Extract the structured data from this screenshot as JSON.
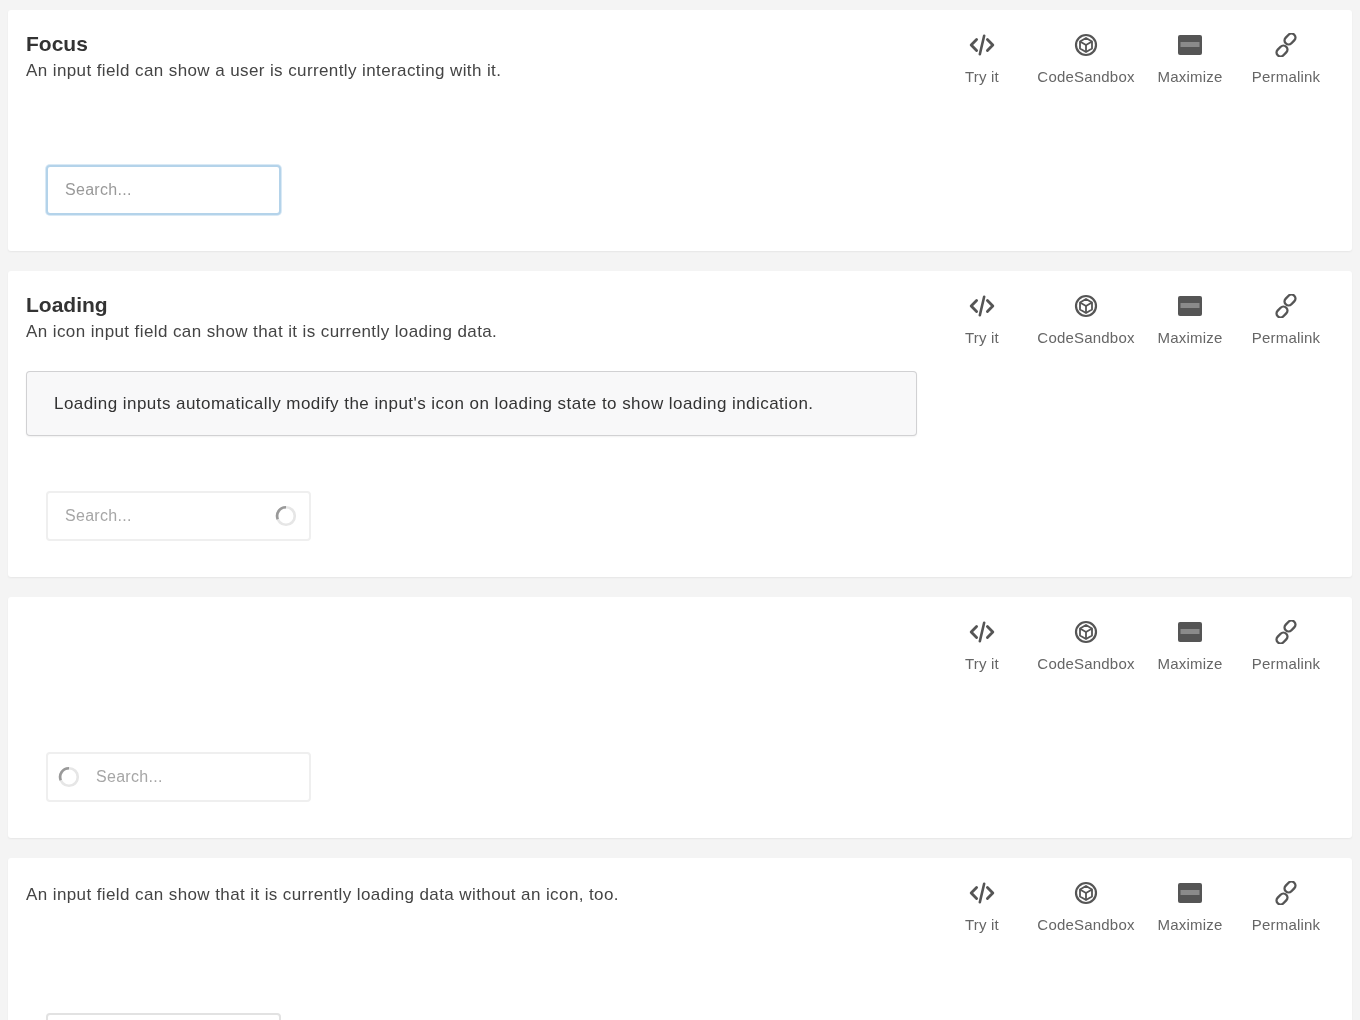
{
  "examples": [
    {
      "title": "Focus",
      "description": "An input field can show a user is currently interacting with it.",
      "toolbar": [
        {
          "label": "Try it"
        },
        {
          "label": "CodeSandbox"
        },
        {
          "label": "Maximize"
        },
        {
          "label": "Permalink"
        }
      ],
      "input": {
        "kind": "plain",
        "placeholder": "Search...",
        "focused": true,
        "loading": false
      }
    },
    {
      "title": "Loading",
      "description": "An icon input field can show that it is currently loading data.",
      "toolbar": [
        {
          "label": "Try it"
        },
        {
          "label": "CodeSandbox"
        },
        {
          "label": "Maximize"
        },
        {
          "label": "Permalink"
        }
      ],
      "message": "Loading inputs automatically modify the input's icon on loading state to show loading indication.",
      "input": {
        "kind": "right-icon",
        "placeholder": "Search...",
        "focused": false,
        "loading": true
      }
    },
    {
      "toolbar": [
        {
          "label": "Try it"
        },
        {
          "label": "CodeSandbox"
        },
        {
          "label": "Maximize"
        },
        {
          "label": "Permalink"
        }
      ],
      "input": {
        "kind": "left-icon",
        "placeholder": "Search...",
        "focused": false,
        "loading": true
      }
    },
    {
      "description": "An input field can show that it is currently loading data without an icon, too.",
      "toolbar": [
        {
          "label": "Try it"
        },
        {
          "label": "CodeSandbox"
        },
        {
          "label": "Maximize"
        },
        {
          "label": "Permalink"
        }
      ],
      "input": {
        "focused": false
      }
    }
  ]
}
